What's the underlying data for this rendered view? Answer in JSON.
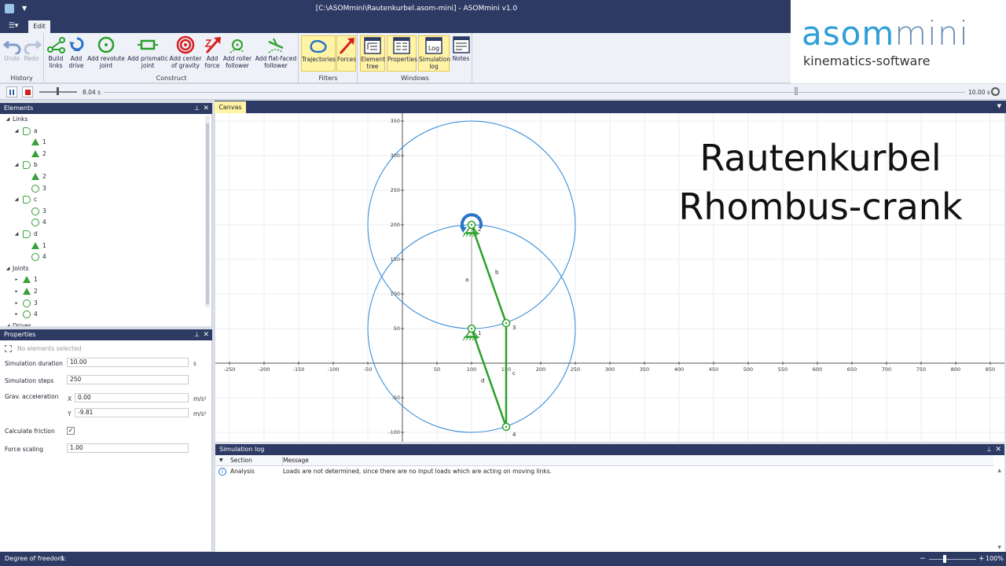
{
  "titlebar": {
    "title": "[C:\\ASOMmini\\Rautenkurbel.asom-mini] - ASOMmini v1.0",
    "tab_edit": "Edit"
  },
  "ribbon": {
    "history": {
      "label": "History",
      "buttons": [
        {
          "label": "Undo",
          "icon": "undo-icon"
        },
        {
          "label": "Redo",
          "icon": "redo-icon"
        }
      ]
    },
    "construct": {
      "label": "Construct",
      "buttons": [
        {
          "label": "Build links",
          "icon": "build-links-icon"
        },
        {
          "label": "Add drive",
          "icon": "add-drive-icon"
        },
        {
          "label": "Add revolute joint",
          "icon": "revolute-joint-icon"
        },
        {
          "label": "Add prismatic joint",
          "icon": "prismatic-joint-icon"
        },
        {
          "label": "Add center of gravity",
          "icon": "center-of-gravity-icon"
        },
        {
          "label": "Add force",
          "icon": "force-icon"
        },
        {
          "label": "Add roller follower",
          "icon": "roller-follower-icon"
        },
        {
          "label": "Add flat-faced follower",
          "icon": "flat-follower-icon"
        }
      ]
    },
    "filters": {
      "label": "Filters",
      "buttons": [
        {
          "label": "Trajectories",
          "icon": "trajectories-icon"
        },
        {
          "label": "Forces",
          "icon": "forces-icon"
        }
      ]
    },
    "windows": {
      "label": "Windows",
      "buttons": [
        {
          "label": "Element tree",
          "icon": "element-tree-icon"
        },
        {
          "label": "Properties",
          "icon": "properties-icon"
        },
        {
          "label": "Simulation log",
          "icon": "log-icon"
        },
        {
          "label": "Notes",
          "icon": "notes-icon"
        }
      ]
    }
  },
  "logo": {
    "brand_a": "asom",
    "brand_b": "mini",
    "tagline": "kinematics-software"
  },
  "simbar": {
    "current_time": "8.04 s",
    "end_time": "10.00 s",
    "progress": 0.804
  },
  "elements": {
    "title": "Elements",
    "tree": [
      {
        "level": 0,
        "label": "Links",
        "icon": ""
      },
      {
        "level": 1,
        "label": "a",
        "icon": "link"
      },
      {
        "level": 2,
        "label": "1",
        "icon": "tri"
      },
      {
        "level": 2,
        "label": "2",
        "icon": "tri"
      },
      {
        "level": 1,
        "label": "b",
        "icon": "link"
      },
      {
        "level": 2,
        "label": "2",
        "icon": "tri"
      },
      {
        "level": 2,
        "label": "3",
        "icon": "rev"
      },
      {
        "level": 1,
        "label": "c",
        "icon": "link"
      },
      {
        "level": 2,
        "label": "3",
        "icon": "rev"
      },
      {
        "level": 2,
        "label": "4",
        "icon": "rev"
      },
      {
        "level": 1,
        "label": "d",
        "icon": "link"
      },
      {
        "level": 2,
        "label": "1",
        "icon": "tri"
      },
      {
        "level": 2,
        "label": "4",
        "icon": "rev"
      },
      {
        "level": 0,
        "label": "Joints",
        "icon": ""
      },
      {
        "level": 1,
        "label": "1",
        "icon": "tri"
      },
      {
        "level": 1,
        "label": "2",
        "icon": "tri"
      },
      {
        "level": 1,
        "label": "3",
        "icon": "rev"
      },
      {
        "level": 1,
        "label": "4",
        "icon": "rev"
      },
      {
        "level": 0,
        "label": "Drives",
        "icon": ""
      }
    ]
  },
  "properties": {
    "title": "Properties",
    "no_selection": "No elements selected",
    "sim_duration_label": "Simulation duration",
    "sim_duration_value": "10.00",
    "sim_duration_unit": "s",
    "sim_steps_label": "Simulation steps",
    "sim_steps_value": "250",
    "grav_label": "Grav. acceleration",
    "grav_x_label": "X",
    "grav_x_value": "0.00",
    "grav_y_label": "Y",
    "grav_y_value": "-9.81",
    "grav_unit": "m/s²",
    "friction_label": "Calculate friction",
    "friction_checked": "✓",
    "force_scaling_label": "Force scaling",
    "force_scaling_value": "1.00"
  },
  "canvas": {
    "tab": "Canvas",
    "headline_1": "Rautenkurbel",
    "headline_2": "Rhombus-crank",
    "x_ticks": [
      -250,
      -200,
      -150,
      -100,
      -50,
      50,
      100,
      150,
      200,
      250,
      300,
      350,
      400,
      450,
      500,
      550,
      600,
      650,
      700,
      750,
      800,
      850
    ],
    "y_ticks": [
      350,
      300,
      250,
      200,
      150,
      100,
      50,
      -50,
      -100
    ],
    "joints": [
      {
        "id": "1",
        "x": 100,
        "y": 50,
        "ground": true
      },
      {
        "id": "2",
        "x": 100,
        "y": 200,
        "ground": true
      },
      {
        "id": "3",
        "x": 150,
        "y": 58
      },
      {
        "id": "4",
        "x": 150,
        "y": -92
      }
    ],
    "links": [
      {
        "id": "a",
        "from": "1",
        "to": "2",
        "color": "#bbbbbb"
      },
      {
        "id": "b",
        "from": "2",
        "to": "3",
        "color": "#2aa02a"
      },
      {
        "id": "c",
        "from": "3",
        "to": "4",
        "color": "#2aa02a"
      },
      {
        "id": "d",
        "from": "1",
        "to": "4",
        "color": "#2aa02a"
      }
    ],
    "circles": [
      {
        "cx": 100,
        "cy": 200,
        "r": 150
      },
      {
        "cx": 100,
        "cy": 50,
        "r": 150
      }
    ],
    "colors": {
      "trajectory": "#2b86d6",
      "link": "#2aa02a",
      "grid": "#eceef3",
      "axis": "#555555"
    }
  },
  "log": {
    "title": "Simulation log",
    "col_section": "Section",
    "col_message": "Message",
    "rows": [
      {
        "section": "Analysis",
        "message": "Loads are not determined, since there are no input loads which are acting on moving links."
      }
    ]
  },
  "status": {
    "dof_label": "Degree of freedom:",
    "dof_value": "1",
    "zoom": "100%"
  }
}
